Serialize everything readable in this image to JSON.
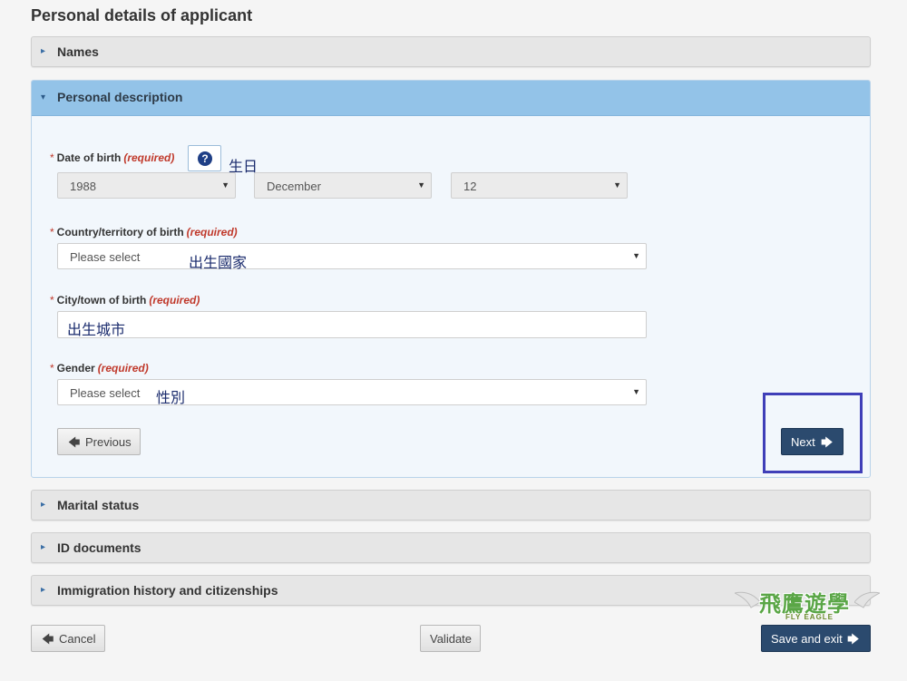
{
  "page": {
    "title": "Personal details of applicant"
  },
  "panels": {
    "names": {
      "title": "Names"
    },
    "personal_description": {
      "title": "Personal description"
    },
    "marital_status": {
      "title": "Marital status"
    },
    "id_documents": {
      "title": "ID documents"
    },
    "immigration": {
      "title": "Immigration history and citizenships"
    }
  },
  "form": {
    "required_marker": "*",
    "required_text": "(required)",
    "dob": {
      "label": "Date of birth",
      "year": "1988",
      "month": "December",
      "day": "12",
      "annotation": "生日"
    },
    "country": {
      "label": "Country/territory of birth",
      "value": "Please select",
      "annotation": "出生國家"
    },
    "city": {
      "label": "City/town of birth",
      "annotation": "出生城市"
    },
    "gender": {
      "label": "Gender",
      "value": "Please select",
      "annotation": "性別"
    }
  },
  "buttons": {
    "previous": "Previous",
    "next": "Next",
    "cancel": "Cancel",
    "validate": "Validate",
    "save_exit": "Save and exit"
  },
  "icons": {
    "caret_right": "▸",
    "caret_down": "▾",
    "arrow_left": "🡄",
    "arrow_right": "🡆",
    "help": "?"
  },
  "logo": {
    "cn": "飛鷹遊學",
    "en": "FLY EAGLE"
  },
  "colors": {
    "primary": "#2b4a6e",
    "panel_head": "#93c3e8",
    "required": "#c0392b",
    "highlight": "#3f3fb8"
  }
}
